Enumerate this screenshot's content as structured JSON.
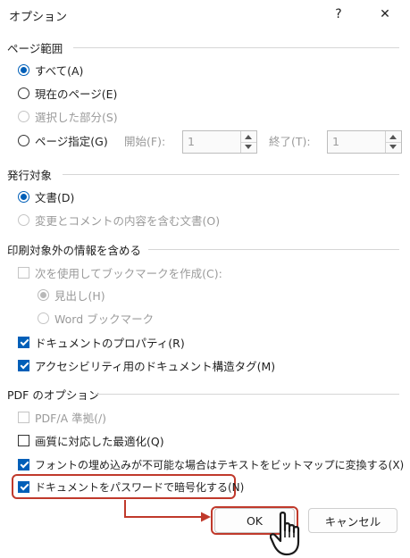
{
  "dialog": {
    "title": "オプション",
    "help_label": "?",
    "close_label": "✕"
  },
  "page_range": {
    "heading": "ページ範囲",
    "all": "すべて(A)",
    "current": "現在のページ(E)",
    "selection": "選択した部分(S)",
    "pages": "ページ指定(G)",
    "from_label": "開始(F):",
    "from_value": "1",
    "to_label": "終了(T):",
    "to_value": "1"
  },
  "publish_what": {
    "heading": "発行対象",
    "document": "文書(D)",
    "markup": "変更とコメントの内容を含む文書(O)"
  },
  "non_printing": {
    "heading": "印刷対象外の情報を含める",
    "create_bookmarks": "次を使用してブックマークを作成(C):",
    "headings": "見出し(H)",
    "word_bookmarks": "Word ブックマーク",
    "doc_properties": "ドキュメントのプロパティ(R)",
    "structure_tags": "アクセシビリティ用のドキュメント構造タグ(M)"
  },
  "pdf_options": {
    "heading": "PDF のオプション",
    "pdfa": "PDF/A 準拠(/)",
    "optimize": "画質に対応した最適化(Q)",
    "bitmap_text": "フォントの埋め込みが不可能な場合はテキストをビットマップに変換する(X)",
    "encrypt": "ドキュメントをパスワードで暗号化する(N)"
  },
  "buttons": {
    "ok": "OK",
    "cancel": "キャンセル"
  },
  "annotation": {
    "highlight_color": "#c0392b"
  }
}
